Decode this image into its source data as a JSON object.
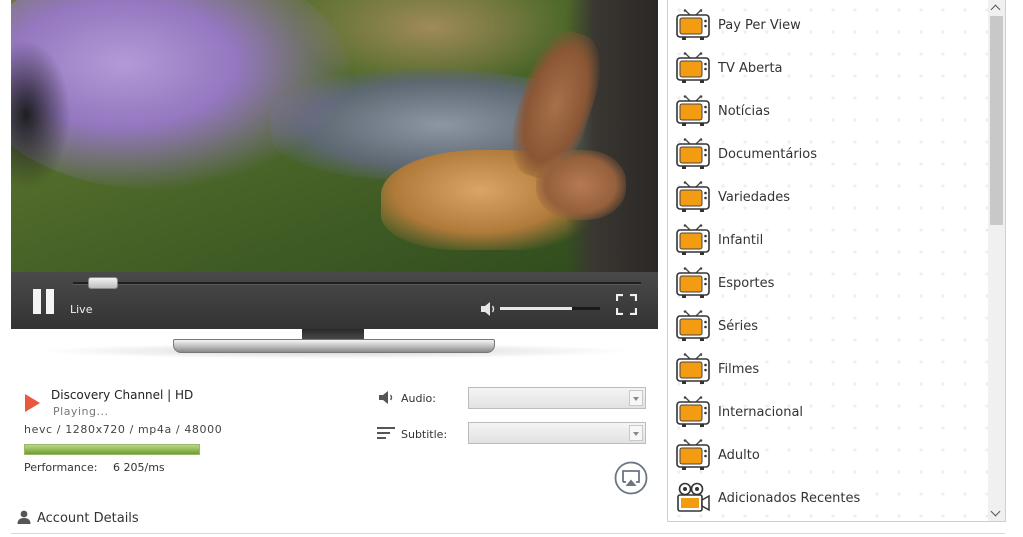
{
  "player": {
    "live_label": "Live",
    "seek_progress": 0.05,
    "volume_level": 0.72
  },
  "now_playing": {
    "channel": "Discovery Channel | HD",
    "status": "Playing...",
    "stream_info": "hevc / 1280x720 / mp4a / 48000",
    "buffer_level": 1.0,
    "performance_label": "Performance:",
    "performance_value": "6 205/ms"
  },
  "tracks": {
    "audio_label": "Audio:",
    "audio_value": "",
    "subtitle_label": "Subtitle:",
    "subtitle_value": ""
  },
  "account": {
    "label": "Account Details"
  },
  "categories": [
    {
      "label": "Pay Per View",
      "icon": "tv-icon"
    },
    {
      "label": "TV Aberta",
      "icon": "tv-icon"
    },
    {
      "label": "Notícias",
      "icon": "tv-icon"
    },
    {
      "label": "Documentários",
      "icon": "tv-icon"
    },
    {
      "label": "Variedades",
      "icon": "tv-icon"
    },
    {
      "label": "Infantil",
      "icon": "tv-icon"
    },
    {
      "label": "Esportes",
      "icon": "tv-icon"
    },
    {
      "label": "Séries",
      "icon": "tv-icon"
    },
    {
      "label": "Filmes",
      "icon": "tv-icon"
    },
    {
      "label": "Internacional",
      "icon": "tv-icon"
    },
    {
      "label": "Adulto",
      "icon": "tv-icon"
    },
    {
      "label": "Adicionados Recentes",
      "icon": "film-camera-icon"
    }
  ],
  "colors": {
    "accent_orange": "#f39c12",
    "play_red": "#e9573f",
    "buffer_green": "#6f9f2c"
  }
}
